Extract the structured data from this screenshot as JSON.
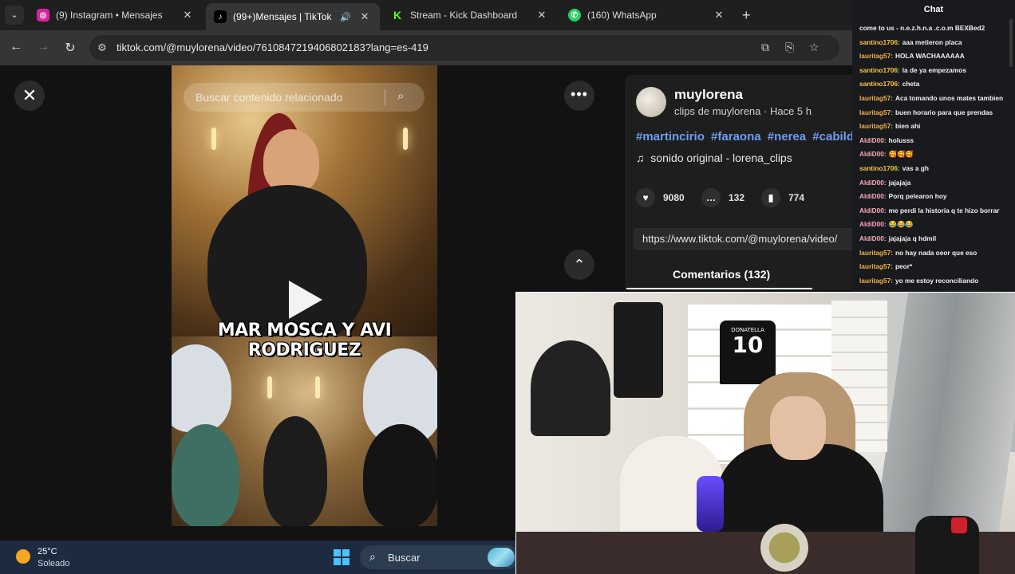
{
  "browser": {
    "tabs": [
      {
        "label": "(9) Instagram • Mensajes",
        "favicon": "instagram-icon",
        "color": "#d6249f",
        "active": false
      },
      {
        "label": "(99+)Mensajes | TikTok",
        "favicon": "tiktok-icon",
        "color": "#000000",
        "active": true,
        "audio": true
      },
      {
        "label": "Stream - Kick Dashboard",
        "favicon": "kick-icon",
        "color": "#53fc18",
        "active": false
      },
      {
        "label": "(160) WhatsApp",
        "favicon": "whatsapp-icon",
        "color": "#25d366",
        "active": false
      }
    ],
    "tab_close": "✕",
    "new_tab": "+",
    "url": "tiktok.com/@muylorena/video/7610847219406802183?lang=es-419"
  },
  "video": {
    "search_placeholder": "Buscar contenido relacionado",
    "caption": "MAR MOSCA Y AVI RODRIGUEZ"
  },
  "post": {
    "username": "muylorena",
    "subtitle": "clips de muylorena · Hace 5 h",
    "hashtags": [
      "#martincirio",
      "#faraona",
      "#nerea",
      "#cabildo"
    ],
    "sound": "sonido original - lorena_clips",
    "likes": "9080",
    "comments": "132",
    "saves": "774",
    "link": "https://www.tiktok.com/@muylorena/video/",
    "comments_tab": "Comentarios (132)"
  },
  "taskbar": {
    "temperature": "25°C",
    "condition": "Soleado",
    "search_label": "Buscar"
  },
  "chat": {
    "title": "Chat",
    "messages": [
      {
        "user": "",
        "text": "come to us - n.e.z.h.n.a .c.o.m BEXBed2",
        "color": "#f1f1f1"
      },
      {
        "user": "santino1706:",
        "text": "aaa metieron placa",
        "color": "#f5c542"
      },
      {
        "user": "lauritag57:",
        "text": "HOLA WACHAAAAAA",
        "color": "#f0b24a"
      },
      {
        "user": "santino1706:",
        "text": "la de ya empezamos",
        "color": "#f5c542"
      },
      {
        "user": "santino1706:",
        "text": "cheta",
        "color": "#f5c542"
      },
      {
        "user": "lauritag57:",
        "text": "Aca tomando unos mates tambien",
        "color": "#f0b24a"
      },
      {
        "user": "lauritag57:",
        "text": "buen horario para que prendas",
        "color": "#f0b24a"
      },
      {
        "user": "lauritag57:",
        "text": "bien ahi",
        "color": "#f0b24a"
      },
      {
        "user": "AldiD00:",
        "text": "holusss",
        "color": "#f4a8b8"
      },
      {
        "user": "AldiD00:",
        "text": "🥰🥰🥰",
        "color": "#f4a8b8"
      },
      {
        "user": "santino1706:",
        "text": "vas a gh",
        "color": "#f5c542"
      },
      {
        "user": "AldiD00:",
        "text": "jajajaja",
        "color": "#f4a8b8"
      },
      {
        "user": "AldiD00:",
        "text": "Porq pelearon hoy",
        "color": "#f4a8b8"
      },
      {
        "user": "AldiD00:",
        "text": "me perdi la historia q te hizo borrar",
        "color": "#f4a8b8"
      },
      {
        "user": "AldiD00:",
        "text": "😂😂😂",
        "color": "#f4a8b8"
      },
      {
        "user": "AldiD00:",
        "text": "jajajaja q hdmil",
        "color": "#f4a8b8"
      },
      {
        "user": "lauritag57:",
        "text": "no hay nada oeor que eso",
        "color": "#f0b24a"
      },
      {
        "user": "lauritag57:",
        "text": "peor*",
        "color": "#f0b24a"
      },
      {
        "user": "lauritag57:",
        "text": "yo me estoy reconciliando",
        "color": "#f0b24a"
      }
    ]
  },
  "webcam": {
    "jersey_name": "DONATELLA",
    "jersey_number": "10"
  }
}
